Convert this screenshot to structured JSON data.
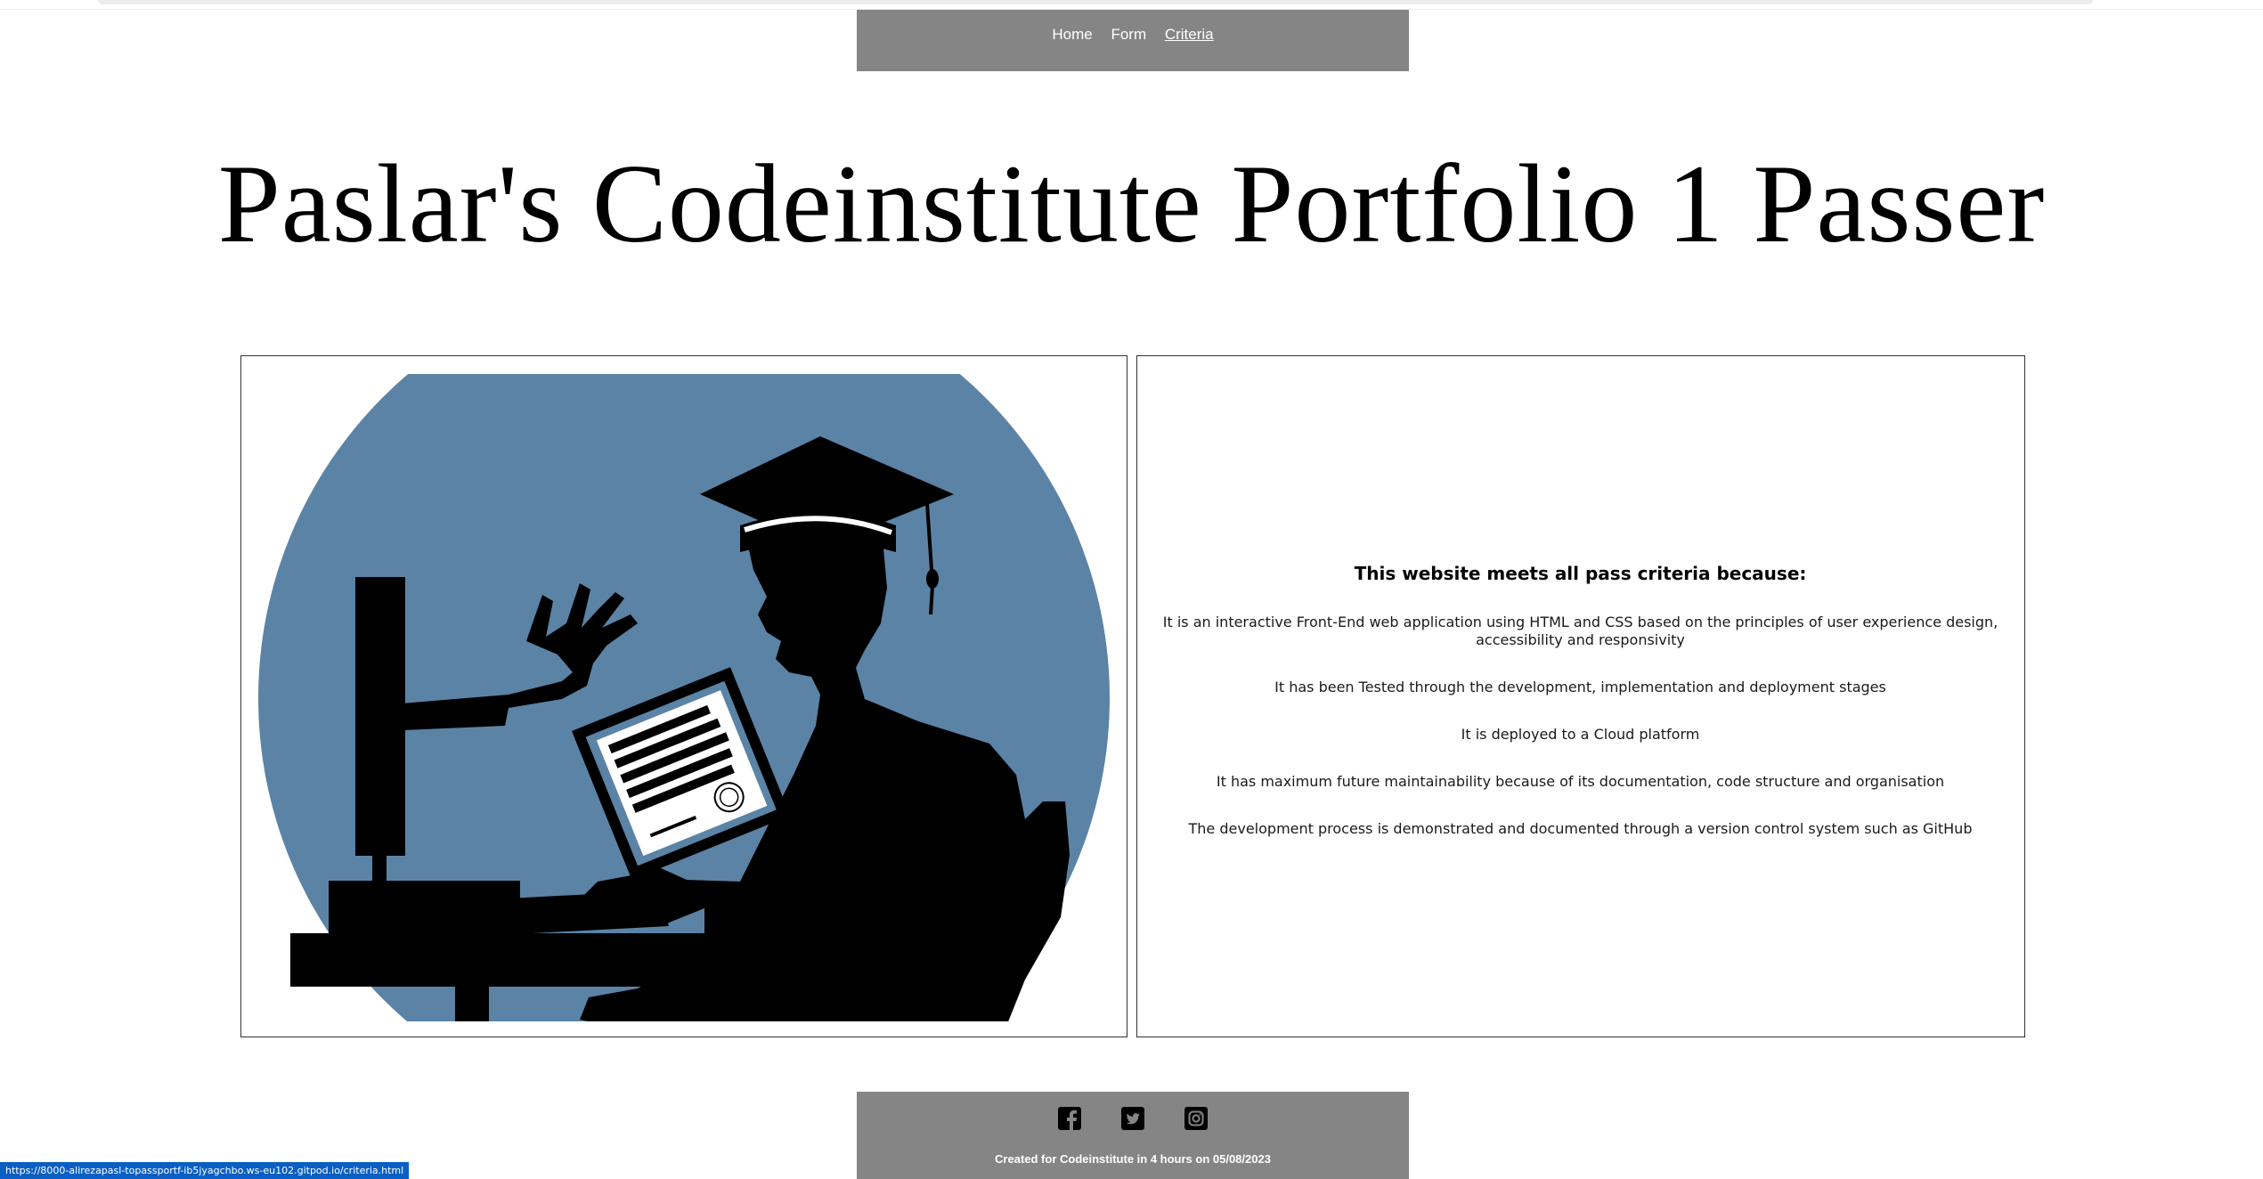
{
  "nav": {
    "items": [
      {
        "label": "Home"
      },
      {
        "label": "Form"
      },
      {
        "label": "Criteria",
        "active": true
      }
    ]
  },
  "hero": {
    "title": "Paslar's Codeinstitute Portfolio 1 Passer"
  },
  "criteria": {
    "heading": "This website meets all pass criteria because:",
    "items": [
      "It is an interactive Front-End web application using HTML and CSS based on the principles of user experience design, accessibility and responsivity",
      "It has been Tested through the development, implementation and deployment stages",
      "It is deployed to a Cloud platform",
      "It has maximum future maintainability because of its documentation, code structure and organisation",
      "The development process is demonstrated and documented through a version control system such as GitHub"
    ]
  },
  "footer": {
    "icons": [
      "facebook-icon",
      "twitter-icon",
      "instagram-icon"
    ],
    "credit": "Created for Codeinstitute  in 4 hours on 05/08/2023"
  },
  "status_bar": {
    "url": "https://8000-alirezapasl-topassportf-ib5jyagchbo.ws-eu102.gitpod.io/criteria.html"
  },
  "colors": {
    "nav_bg": "#858585",
    "illustration_circle": "#5b83a6",
    "status_bg": "#0a5fc4"
  }
}
